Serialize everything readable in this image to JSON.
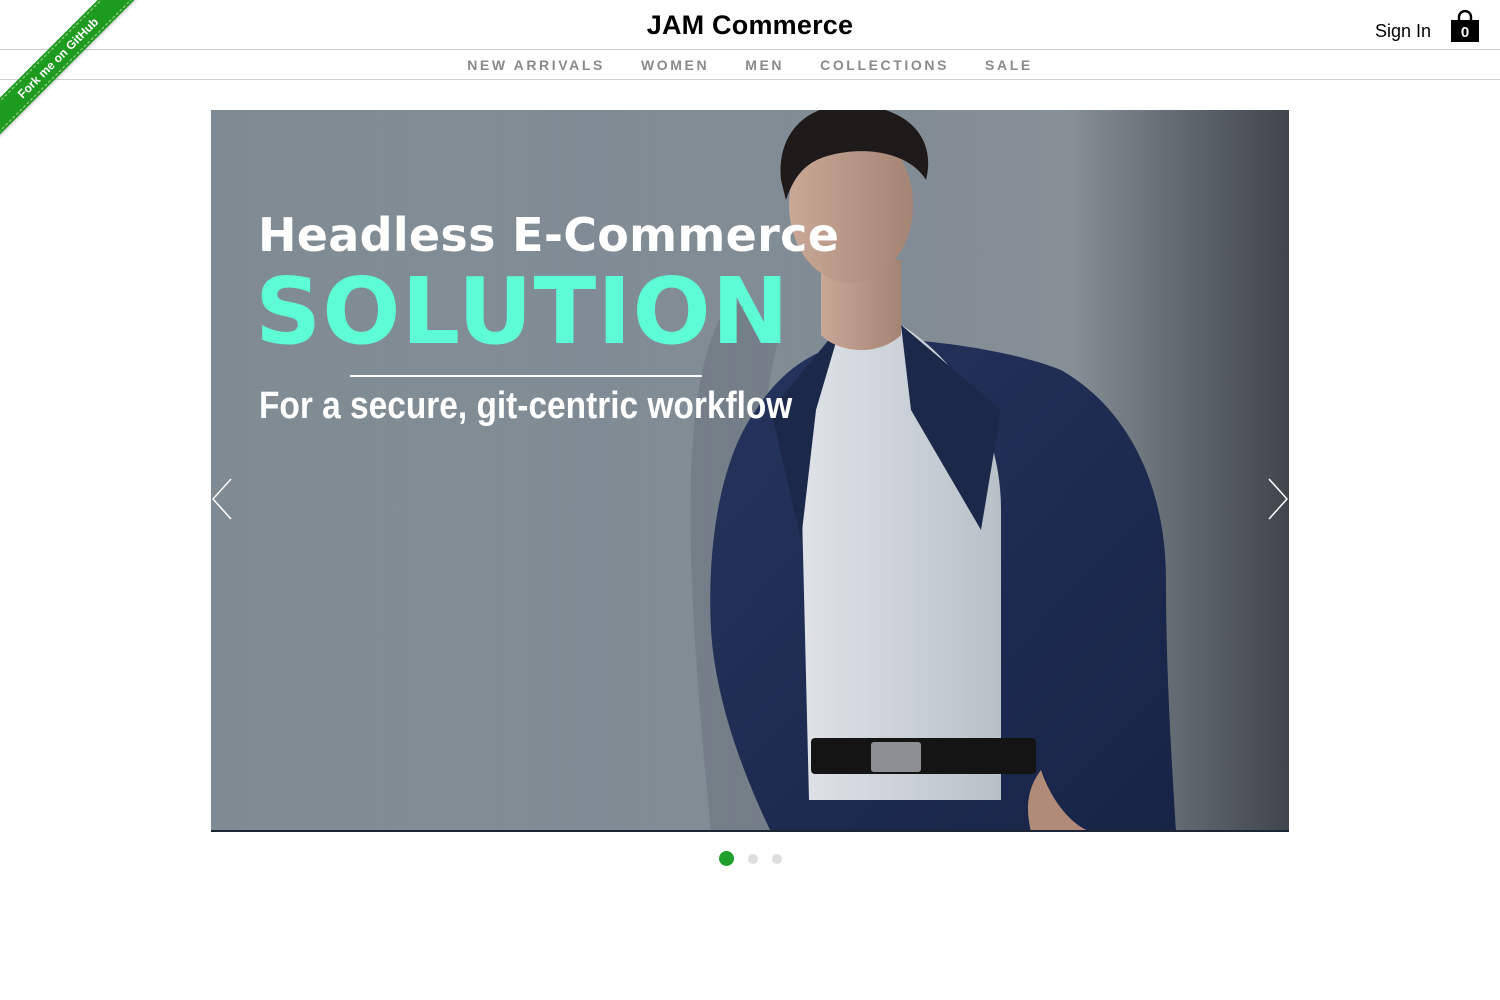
{
  "ribbon": {
    "label": "Fork me on GitHub"
  },
  "header": {
    "brand": "JAM Commerce",
    "sign_in": "Sign In",
    "cart_count": "0"
  },
  "nav": {
    "items": [
      {
        "label": "NEW ARRIVALS"
      },
      {
        "label": "WOMEN"
      },
      {
        "label": "MEN"
      },
      {
        "label": "COLLECTIONS"
      },
      {
        "label": "SALE"
      }
    ]
  },
  "hero": {
    "headline": "Headless E-Commerce",
    "highlight": "SOLUTION",
    "subtitle": "For a secure, git-centric workflow",
    "prev_icon": "chevron-left-icon",
    "next_icon": "chevron-right-icon"
  },
  "slider": {
    "dots": 3,
    "active_index": 0
  },
  "colors": {
    "accent": "#5dfcd5",
    "ribbon": "#1e9b1e",
    "active_dot": "#1fa02c",
    "inactive_dot": "#dddddd",
    "nav_text": "#8a8a8a"
  }
}
